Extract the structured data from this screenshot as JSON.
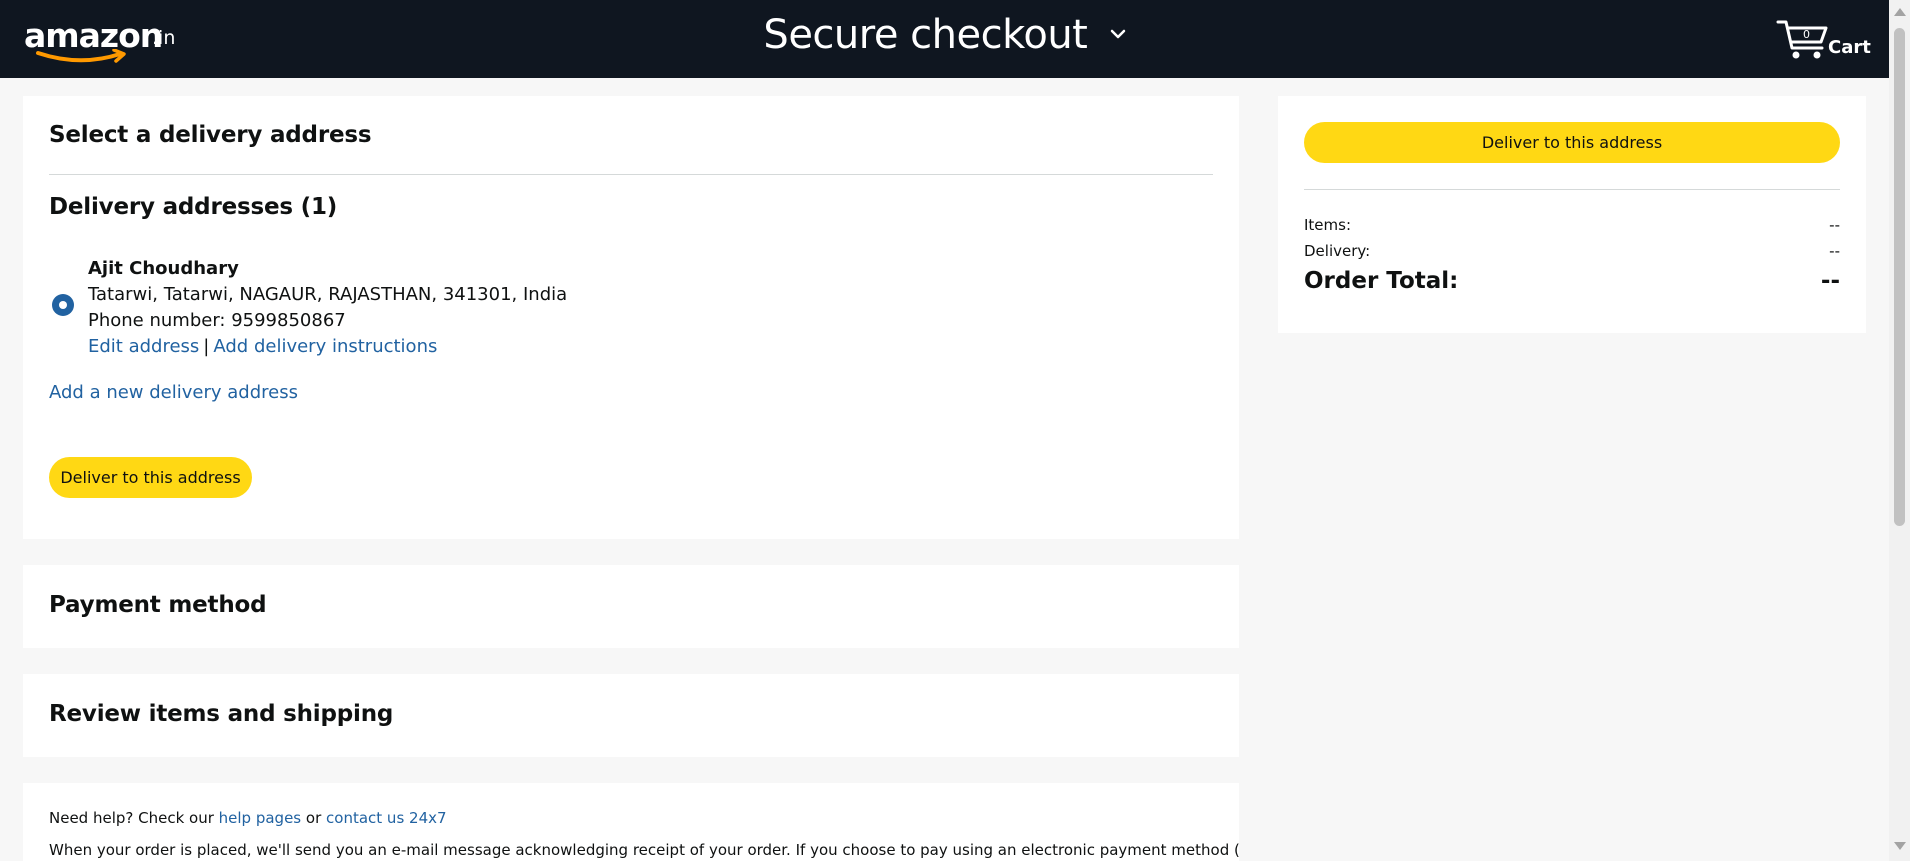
{
  "header": {
    "logo_text": "amazon",
    "logo_tld": ".in",
    "title": "Secure checkout",
    "cart_label": "Cart",
    "cart_icon": "cart-icon",
    "dropdown_icon": "chevron-down-icon"
  },
  "delivery": {
    "section_title": "Select a delivery address",
    "addresses_heading": "Delivery addresses (1)",
    "selected_address": {
      "name": "Ajit Choudhary",
      "address_line": "Tatarwi, Tatarwi, NAGAUR, RAJASTHAN, 341301, India",
      "phone": "Phone number: 9599850867",
      "edit_link": "Edit address",
      "separator": "|",
      "instructions_link": "Add delivery instructions"
    },
    "add_new_link": "Add a new delivery address",
    "deliver_button": "Deliver to this address"
  },
  "payment": {
    "section_title": "Payment method"
  },
  "review": {
    "section_title": "Review items and shipping"
  },
  "help": {
    "prefix": "Need help? Check our ",
    "help_link": "help pages",
    "or_text": " or ",
    "contact_link": "contact us 24x7",
    "notice": "When your order is placed, we'll send you an e-mail message acknowledging receipt of your order. If you choose to pay using an electronic payment method (credit"
  },
  "summary": {
    "deliver_button": "Deliver to this address",
    "items_label": "Items:",
    "items_value": "--",
    "delivery_label": "Delivery:",
    "delivery_value": "--",
    "total_label": "Order Total:",
    "total_value": "--"
  },
  "colors": {
    "header_bg": "#0f1620",
    "button_yellow": "#ffd814",
    "link_blue": "#2162a1",
    "logo_smile": "#ff9900"
  }
}
